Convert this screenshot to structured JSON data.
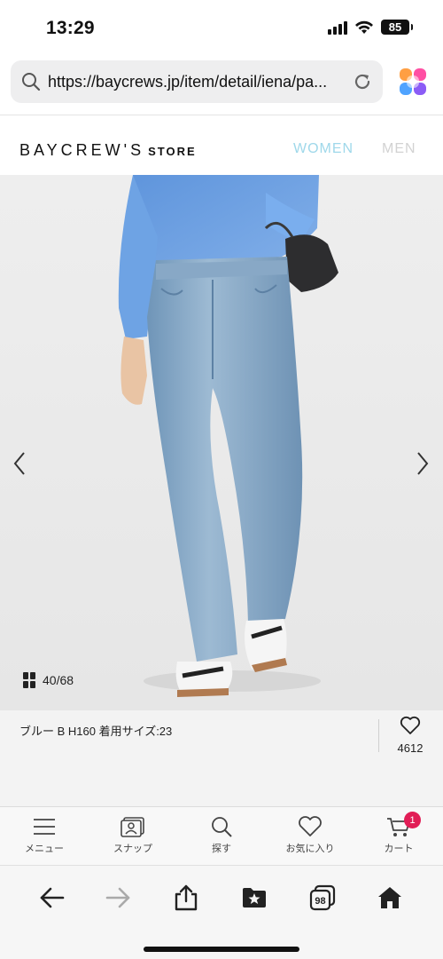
{
  "status_bar": {
    "time": "13:29",
    "battery_level": "85"
  },
  "browser": {
    "url": "https://baycrews.jp/item/detail/iena/pa..."
  },
  "site_header": {
    "brand": "BAYCREW'S",
    "brand_sub": "STORE",
    "nav_women": "WOMEN",
    "nav_men": "MEN",
    "colors": {
      "women": "#9fd8ea",
      "men": "#d2d2d2"
    }
  },
  "product": {
    "image_counter": "40/68",
    "caption": "ブルー B H160 着用サイズ:23",
    "favorite_count": "4612"
  },
  "tab_bar": {
    "items": [
      {
        "label": "メニュー",
        "icon": "menu-icon"
      },
      {
        "label": "スナップ",
        "icon": "snap-icon"
      },
      {
        "label": "探す",
        "icon": "search-icon"
      },
      {
        "label": "お気に入り",
        "icon": "heart-icon"
      },
      {
        "label": "カート",
        "icon": "cart-icon"
      }
    ],
    "cart_badge": "1",
    "badge_color": "#e11d56"
  },
  "browser_toolbar": {
    "tabs_count": "98"
  }
}
